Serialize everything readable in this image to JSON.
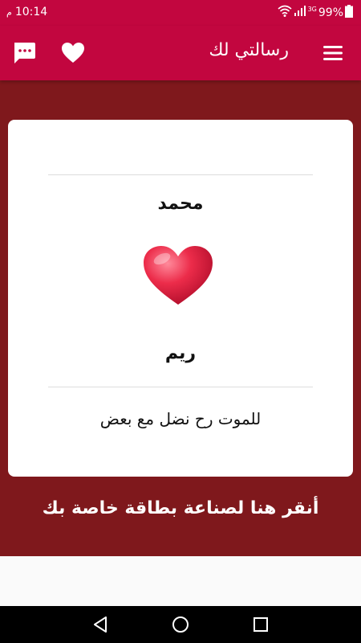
{
  "status_bar": {
    "time": "10:14",
    "ampm": "م",
    "battery": "99%",
    "network": "3G"
  },
  "app_bar": {
    "title": "رسالتي لك"
  },
  "card": {
    "name_top": "محمد",
    "name_bottom": "ريم",
    "message": "للموت رح نضل مع بعض"
  },
  "cta": {
    "label": "أنقر هنا لصناعة بطاقة خاصة بك"
  },
  "icons": {
    "menu": "menu-icon",
    "favorites": "heart-icon",
    "messages": "chat-icon",
    "card_heart": "heart-icon"
  },
  "colors": {
    "primary": "#c2063f",
    "panel": "#7f181c",
    "card": "#ffffff",
    "heart": "#e0243f"
  }
}
